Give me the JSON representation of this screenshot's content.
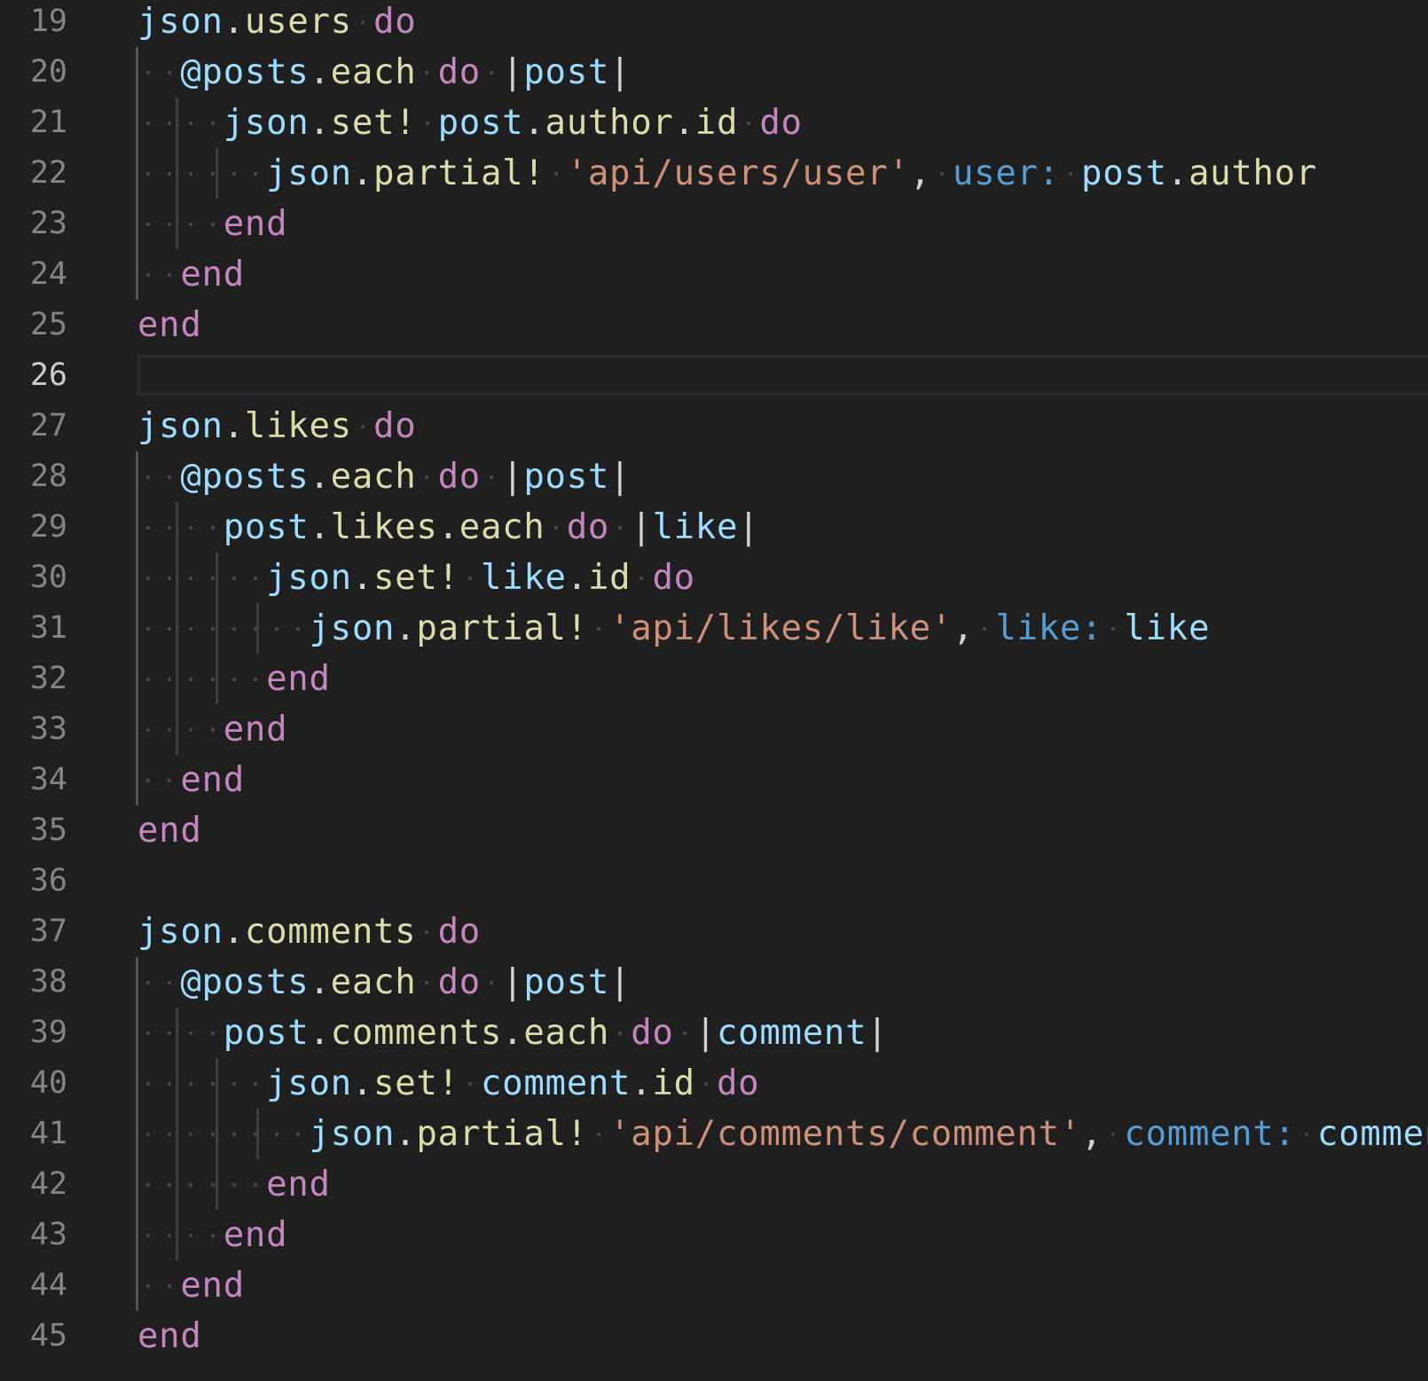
{
  "editor": {
    "active_line": 26,
    "tab_size": 2,
    "colors": {
      "background": "#1f1f1f",
      "line_number": "#858585",
      "line_number_active": "#cccccc",
      "variable": "#9cdcfe",
      "method": "#dcdcaa",
      "keyword": "#c586c0",
      "string": "#ce9178",
      "symbol": "#569cd6"
    },
    "lines": [
      {
        "n": "19",
        "indent": 0,
        "tokens": [
          [
            "var",
            "json"
          ],
          [
            "plain",
            "."
          ],
          [
            "fn",
            "users"
          ],
          [
            "sp",
            ""
          ],
          [
            "kw",
            "do"
          ]
        ]
      },
      {
        "n": "20",
        "indent": 1,
        "tokens": [
          [
            "var",
            "@posts"
          ],
          [
            "plain",
            "."
          ],
          [
            "fn",
            "each"
          ],
          [
            "sp",
            ""
          ],
          [
            "kw",
            "do"
          ],
          [
            "sp",
            ""
          ],
          [
            "pipe",
            "|"
          ],
          [
            "var",
            "post"
          ],
          [
            "pipe",
            "|"
          ]
        ]
      },
      {
        "n": "21",
        "indent": 2,
        "tokens": [
          [
            "var",
            "json"
          ],
          [
            "plain",
            "."
          ],
          [
            "fn",
            "set!"
          ],
          [
            "sp",
            ""
          ],
          [
            "var",
            "post"
          ],
          [
            "plain",
            "."
          ],
          [
            "fn",
            "author"
          ],
          [
            "plain",
            "."
          ],
          [
            "fn",
            "id"
          ],
          [
            "sp",
            ""
          ],
          [
            "kw",
            "do"
          ]
        ]
      },
      {
        "n": "22",
        "indent": 3,
        "tokens": [
          [
            "var",
            "json"
          ],
          [
            "plain",
            "."
          ],
          [
            "fn",
            "partial!"
          ],
          [
            "sp",
            ""
          ],
          [
            "str",
            "'api/users/user'"
          ],
          [
            "plain",
            ","
          ],
          [
            "sp",
            ""
          ],
          [
            "sym",
            "user:"
          ],
          [
            "sp",
            ""
          ],
          [
            "var",
            "post"
          ],
          [
            "plain",
            "."
          ],
          [
            "fn",
            "author"
          ]
        ]
      },
      {
        "n": "23",
        "indent": 2,
        "tokens": [
          [
            "kw",
            "end"
          ]
        ]
      },
      {
        "n": "24",
        "indent": 1,
        "tokens": [
          [
            "kw",
            "end"
          ]
        ]
      },
      {
        "n": "25",
        "indent": 0,
        "tokens": [
          [
            "kw",
            "end"
          ]
        ]
      },
      {
        "n": "26",
        "indent": 0,
        "tokens": []
      },
      {
        "n": "27",
        "indent": 0,
        "tokens": [
          [
            "var",
            "json"
          ],
          [
            "plain",
            "."
          ],
          [
            "fn",
            "likes"
          ],
          [
            "sp",
            ""
          ],
          [
            "kw",
            "do"
          ]
        ]
      },
      {
        "n": "28",
        "indent": 1,
        "tokens": [
          [
            "var",
            "@posts"
          ],
          [
            "plain",
            "."
          ],
          [
            "fn",
            "each"
          ],
          [
            "sp",
            ""
          ],
          [
            "kw",
            "do"
          ],
          [
            "sp",
            ""
          ],
          [
            "pipe",
            "|"
          ],
          [
            "var",
            "post"
          ],
          [
            "pipe",
            "|"
          ]
        ]
      },
      {
        "n": "29",
        "indent": 2,
        "tokens": [
          [
            "var",
            "post"
          ],
          [
            "plain",
            "."
          ],
          [
            "fn",
            "likes"
          ],
          [
            "plain",
            "."
          ],
          [
            "fn",
            "each"
          ],
          [
            "sp",
            ""
          ],
          [
            "kw",
            "do"
          ],
          [
            "sp",
            ""
          ],
          [
            "pipe",
            "|"
          ],
          [
            "var",
            "like"
          ],
          [
            "pipe",
            "|"
          ]
        ]
      },
      {
        "n": "30",
        "indent": 3,
        "tokens": [
          [
            "var",
            "json"
          ],
          [
            "plain",
            "."
          ],
          [
            "fn",
            "set!"
          ],
          [
            "sp",
            ""
          ],
          [
            "var",
            "like"
          ],
          [
            "plain",
            "."
          ],
          [
            "fn",
            "id"
          ],
          [
            "sp",
            ""
          ],
          [
            "kw",
            "do"
          ]
        ]
      },
      {
        "n": "31",
        "indent": 4,
        "tokens": [
          [
            "var",
            "json"
          ],
          [
            "plain",
            "."
          ],
          [
            "fn",
            "partial!"
          ],
          [
            "sp",
            ""
          ],
          [
            "str",
            "'api/likes/like'"
          ],
          [
            "plain",
            ","
          ],
          [
            "sp",
            ""
          ],
          [
            "sym",
            "like:"
          ],
          [
            "sp",
            ""
          ],
          [
            "var",
            "like"
          ]
        ]
      },
      {
        "n": "32",
        "indent": 3,
        "tokens": [
          [
            "kw",
            "end"
          ]
        ]
      },
      {
        "n": "33",
        "indent": 2,
        "tokens": [
          [
            "kw",
            "end"
          ]
        ]
      },
      {
        "n": "34",
        "indent": 1,
        "tokens": [
          [
            "kw",
            "end"
          ]
        ]
      },
      {
        "n": "35",
        "indent": 0,
        "tokens": [
          [
            "kw",
            "end"
          ]
        ]
      },
      {
        "n": "36",
        "indent": 0,
        "tokens": []
      },
      {
        "n": "37",
        "indent": 0,
        "tokens": [
          [
            "var",
            "json"
          ],
          [
            "plain",
            "."
          ],
          [
            "fn",
            "comments"
          ],
          [
            "sp",
            ""
          ],
          [
            "kw",
            "do"
          ]
        ]
      },
      {
        "n": "38",
        "indent": 1,
        "tokens": [
          [
            "var",
            "@posts"
          ],
          [
            "plain",
            "."
          ],
          [
            "fn",
            "each"
          ],
          [
            "sp",
            ""
          ],
          [
            "kw",
            "do"
          ],
          [
            "sp",
            ""
          ],
          [
            "pipe",
            "|"
          ],
          [
            "var",
            "post"
          ],
          [
            "pipe",
            "|"
          ]
        ]
      },
      {
        "n": "39",
        "indent": 2,
        "tokens": [
          [
            "var",
            "post"
          ],
          [
            "plain",
            "."
          ],
          [
            "fn",
            "comments"
          ],
          [
            "plain",
            "."
          ],
          [
            "fn",
            "each"
          ],
          [
            "sp",
            ""
          ],
          [
            "kw",
            "do"
          ],
          [
            "sp",
            ""
          ],
          [
            "pipe",
            "|"
          ],
          [
            "var",
            "comment"
          ],
          [
            "pipe",
            "|"
          ]
        ]
      },
      {
        "n": "40",
        "indent": 3,
        "tokens": [
          [
            "var",
            "json"
          ],
          [
            "plain",
            "."
          ],
          [
            "fn",
            "set!"
          ],
          [
            "sp",
            ""
          ],
          [
            "var",
            "comment"
          ],
          [
            "plain",
            "."
          ],
          [
            "fn",
            "id"
          ],
          [
            "sp",
            ""
          ],
          [
            "kw",
            "do"
          ]
        ]
      },
      {
        "n": "41",
        "indent": 4,
        "tokens": [
          [
            "var",
            "json"
          ],
          [
            "plain",
            "."
          ],
          [
            "fn",
            "partial!"
          ],
          [
            "sp",
            ""
          ],
          [
            "str",
            "'api/comments/comment'"
          ],
          [
            "plain",
            ","
          ],
          [
            "sp",
            ""
          ],
          [
            "sym",
            "comment:"
          ],
          [
            "sp",
            ""
          ],
          [
            "var",
            "comment"
          ]
        ]
      },
      {
        "n": "42",
        "indent": 3,
        "tokens": [
          [
            "kw",
            "end"
          ]
        ]
      },
      {
        "n": "43",
        "indent": 2,
        "tokens": [
          [
            "kw",
            "end"
          ]
        ]
      },
      {
        "n": "44",
        "indent": 1,
        "tokens": [
          [
            "kw",
            "end"
          ]
        ]
      },
      {
        "n": "45",
        "indent": 0,
        "tokens": [
          [
            "kw",
            "end"
          ]
        ]
      }
    ]
  }
}
